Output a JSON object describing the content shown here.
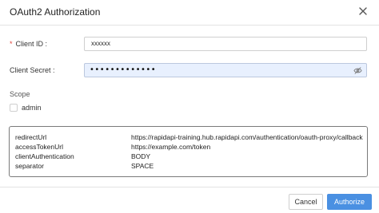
{
  "dialog": {
    "title": "OAuth2 Authorization",
    "close_icon": "close-icon"
  },
  "form": {
    "client_id": {
      "required_mark": "*",
      "label": "Client ID :",
      "value": "xxxxxx"
    },
    "client_secret": {
      "label": "Client Secret :",
      "masked_value": "•••••••••••••",
      "visibility_icon": "eye-off-icon"
    },
    "scope": {
      "label": "Scope",
      "options": [
        {
          "label": "admin",
          "checked": false
        }
      ]
    }
  },
  "info": {
    "rows": [
      {
        "key": "redirectUrl",
        "value": "https://rapidapi-training.hub.rapidapi.com/authentication/oauth-proxy/callback"
      },
      {
        "key": "accessTokenUrl",
        "value": "https://example.com/token"
      },
      {
        "key": "clientAuthentication",
        "value": "BODY"
      },
      {
        "key": "separator",
        "value": "SPACE"
      }
    ]
  },
  "footer": {
    "cancel_label": "Cancel",
    "authorize_label": "Authorize"
  },
  "colors": {
    "primary": "#4a90e2",
    "required": "#e0433a",
    "autofill_bg": "#e8f0fe"
  }
}
